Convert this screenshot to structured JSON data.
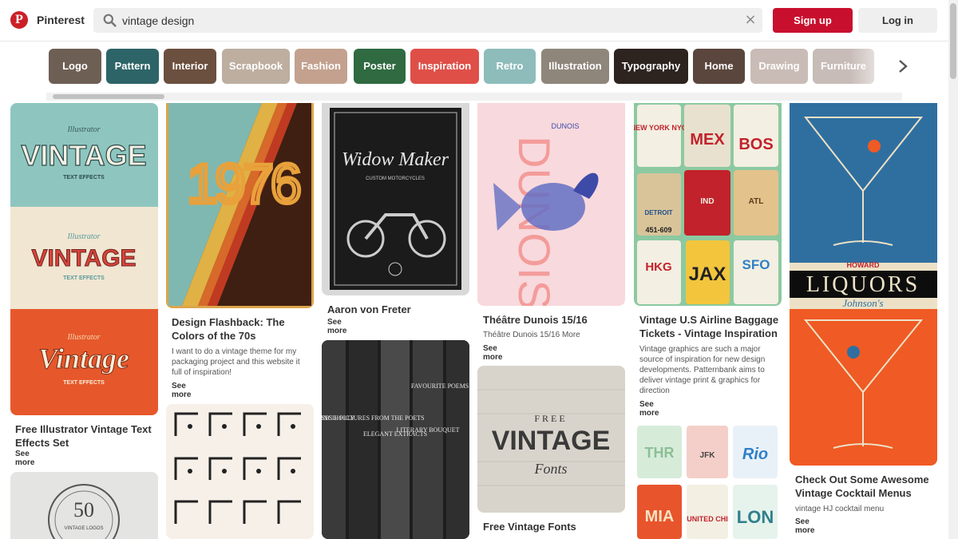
{
  "header": {
    "brand": "Pinterest",
    "search_value": "vintage design",
    "clear_glyph": "×",
    "signup_label": "Sign up",
    "login_label": "Log in",
    "brand_color": "#cb1f27"
  },
  "guides": [
    {
      "label": "Logo",
      "color": "#6e5f55"
    },
    {
      "label": "Pattern",
      "color": "#2d6467"
    },
    {
      "label": "Interior",
      "color": "#6b4f3f"
    },
    {
      "label": "Scrapbook",
      "color": "#bdaea0"
    },
    {
      "label": "Fashion",
      "color": "#c3a18e"
    },
    {
      "label": "Poster",
      "color": "#2f6a41"
    },
    {
      "label": "Inspiration",
      "color": "#df4f48"
    },
    {
      "label": "Retro",
      "color": "#8dbcbb"
    },
    {
      "label": "Illustration",
      "color": "#8f867b"
    },
    {
      "label": "Typography",
      "color": "#2d231f"
    },
    {
      "label": "Home",
      "color": "#5a463c"
    },
    {
      "label": "Drawing",
      "color": "#c9bcb6"
    },
    {
      "label": "Furniture",
      "color": "#c8bcb8"
    }
  ],
  "pins": {
    "p1": {
      "title": "Free Illustrator Vintage Text Effects Set",
      "see_more": "See more",
      "art": {
        "v1": "Illustrator",
        "v2": "VINTAGE",
        "v3": "TEXT EFFECTS",
        "v4": "Illustrator",
        "v5": "VINTAGE",
        "v6": "TEXT EFFECTS",
        "v7": "Illustrator",
        "v8": "Vintage",
        "v9": "TEXT EFFECTS"
      }
    },
    "p1b": {
      "art": {
        "num": "50",
        "label": "VINTAGE LOGOS"
      }
    },
    "p2": {
      "title": "Design Flashback: The Colors of the 70s",
      "desc": "I want to do a vintage theme for my packaging project and this website it full of inspiration!",
      "see_more": "See more",
      "art": {
        "year": "1976"
      }
    },
    "p3": {
      "title": "Aaron von Freter",
      "see_more": "See more",
      "art": {
        "name": "Widow Maker",
        "sub": "CUSTOM MOTORCYCLES"
      }
    },
    "p3b": {
      "art": {
        "b1": "ROSES HOLLY",
        "b2": "PEN PENCIL PICTURES FROM THE POETS",
        "b3": "ELEGANT EXTRACTS",
        "b4": "LITERARY BOUQUET",
        "b5": "FAVOURITE POEMS GIFT BARD"
      }
    },
    "p4": {
      "title": "Théâtre Dunois 15/16",
      "desc": "Théâtre Dunois 15/16 More",
      "see_more": "See more",
      "art": {
        "top": "DUNOIS",
        "letters": "DUNOIS"
      }
    },
    "p4b": {
      "title": "Free Vintage Fonts",
      "art": {
        "l1": "FREE",
        "l2": "VINTAGE",
        "l3": "Fonts"
      }
    },
    "p5": {
      "title": "Vintage U.S Airline Baggage Tickets - Vintage Inspiration",
      "desc": "Vintage graphics are such a major source of inspiration for new design developments. Patternbank aims to deliver vintage print & graphics for direction",
      "see_more": "See more",
      "art": {
        "t1": "NEW YORK NYC",
        "t2": "MEX",
        "t3": "BOS",
        "t4": "DETROIT",
        "t5": "IND",
        "t6": "ATL",
        "t7": "451-609",
        "t8": "HKG",
        "t9": "JAX",
        "t10": "SFO"
      }
    },
    "p5b": {
      "art": {
        "t1": "THR",
        "t2": "JFK",
        "t3": "Rio",
        "t4": "MIA",
        "t5": "UNITED CHI",
        "t6": "LON"
      }
    },
    "p6": {
      "title": "Check Out Some Awesome Vintage Cocktail Menus",
      "desc": "vintage HJ cocktail menu",
      "see_more": "See more",
      "art": {
        "l1": "HOWARD",
        "l2": "LIQUORS",
        "l3": "Johnson's"
      }
    }
  }
}
